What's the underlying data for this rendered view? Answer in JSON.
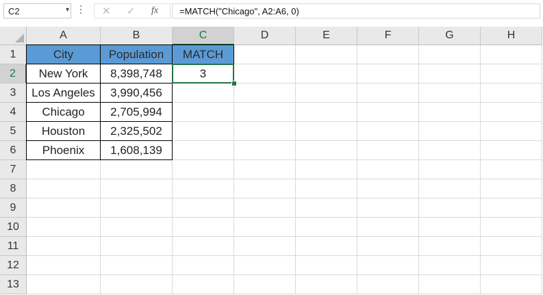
{
  "name_box": {
    "value": "C2",
    "dropdown_icon": "chevron-down-icon"
  },
  "formula_bar": {
    "cancel_icon": "cancel-x-icon",
    "enter_icon": "checkmark-icon",
    "fx_label": "fx",
    "formula": "=MATCH(\"Chicago\", A2:A6, 0)"
  },
  "columns": [
    "A",
    "B",
    "C",
    "D",
    "E",
    "F",
    "G",
    "H"
  ],
  "rows": [
    "1",
    "2",
    "3",
    "4",
    "5",
    "6",
    "7",
    "8",
    "9",
    "10",
    "11",
    "12",
    "13"
  ],
  "selected_cell": "C2",
  "cells": {
    "A1": "City",
    "B1": "Population",
    "C1": "MATCH",
    "A2": "New York",
    "B2": "8,398,748",
    "C2": "3",
    "A3": "Los Angeles",
    "B3": "3,990,456",
    "A4": "Chicago",
    "B4": "2,705,994",
    "A5": "Houston",
    "B5": "2,325,502",
    "A6": "Phoenix",
    "B6": "1,608,139"
  },
  "colors": {
    "header_fill": "#5b9bd5",
    "selection": "#217346"
  }
}
